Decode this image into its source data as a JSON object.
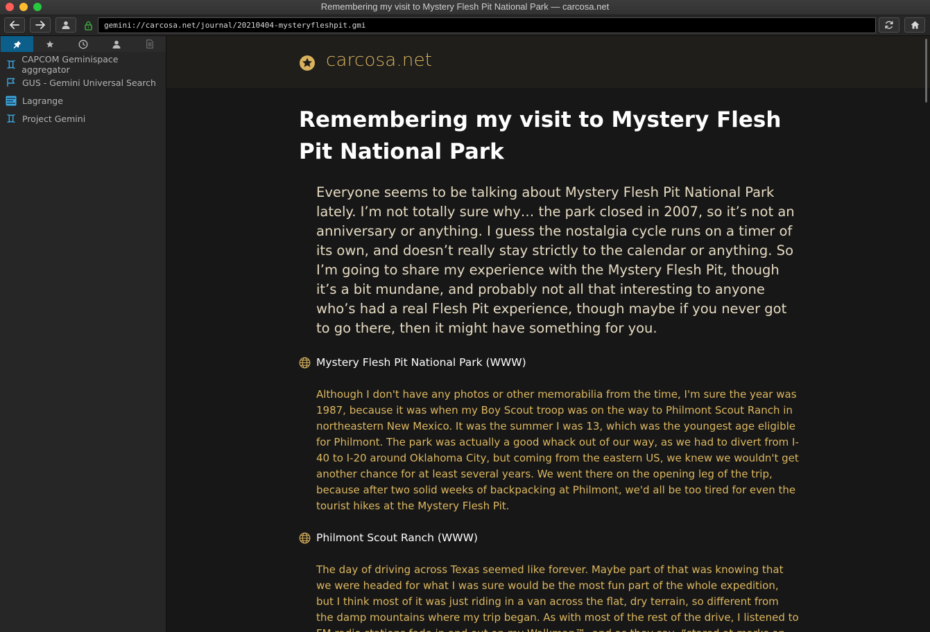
{
  "window": {
    "title": "Remembering my visit to Mystery Flesh Pit National Park — carcosa.net"
  },
  "toolbar": {
    "url": "gemini://carcosa.net/journal/20210404-mysteryfleshpit.gmi",
    "back_icon": "arrow-left",
    "forward_icon": "arrow-right",
    "identity_icon": "user",
    "lock_icon": "lock",
    "reload_icon": "reload",
    "home_icon": "home"
  },
  "sidebar": {
    "tabs": [
      {
        "icon": "pin",
        "active": true
      },
      {
        "icon": "star",
        "active": false
      },
      {
        "icon": "clock",
        "active": false
      },
      {
        "icon": "user",
        "active": false
      },
      {
        "icon": "page",
        "active": false
      }
    ],
    "items": [
      {
        "label": "CAPCOM Geminispace aggregator",
        "icon": "gemini-glyph"
      },
      {
        "label": "GUS - Gemini Universal Search",
        "icon": "flag"
      },
      {
        "label": "Lagrange",
        "icon": "lagrange-logo"
      },
      {
        "label": "Project Gemini",
        "icon": "gemini-glyph"
      }
    ]
  },
  "page": {
    "site_title": "carcosa.net",
    "site_icon": "star-circle",
    "heading": "Remembering my visit to Mystery Flesh Pit National Park",
    "lede": "Everyone seems to be talking about Mystery Flesh Pit National Park lately. I’m not totally sure why… the park closed in 2007, so it’s not an anniversary or anything. I guess the nostalgia cycle runs on a timer of its own, and doesn’t really stay strictly to the calendar or anything. So I’m going to share my experience with the Mystery Flesh Pit, though it’s a bit mundane, and probably not all that interesting to anyone who’s had a real Flesh Pit experience, though maybe if you never got to go there, then it might have something for you.",
    "link1": "Mystery Flesh Pit National Park (WWW)",
    "para1": "Although I don't have any photos or other memorabilia from the time, I'm sure the year was 1987, because it was when my Boy Scout troop was on the way to Philmont Scout Ranch in northeastern New Mexico. It was the summer I was 13, which was the youngest age eligible for Philmont. The park was actually a good whack out of our way, as we had to divert from I-40 to I-20 around Oklahoma City, but coming from the eastern US, we knew we wouldn't get another chance for at least several years. We went there on the opening leg of the trip, because after two solid weeks of backpacking at Philmont, we'd all be too tired for even the tourist hikes at the Mystery Flesh Pit.",
    "link2": "Philmont Scout Ranch (WWW)",
    "para2": "The day of driving across Texas seemed like forever. Maybe part of that was knowing that we were headed for what I was sure would be the most fun part of the whole expedition, but I think most of it was just riding in a van across the flat, dry terrain, so different from the damp mountains where my trip began. As with most of the rest of the drive, I listened to FM radio stations fade in and out on my Walkman™, and as they say, “stared at marks on",
    "link_icon": "globe"
  },
  "colors": {
    "accent": "#dcb75f",
    "site_title": "#d9b25e",
    "active_tab": "#0b5f8a",
    "sidebar_icon": "#3ea6e0"
  }
}
